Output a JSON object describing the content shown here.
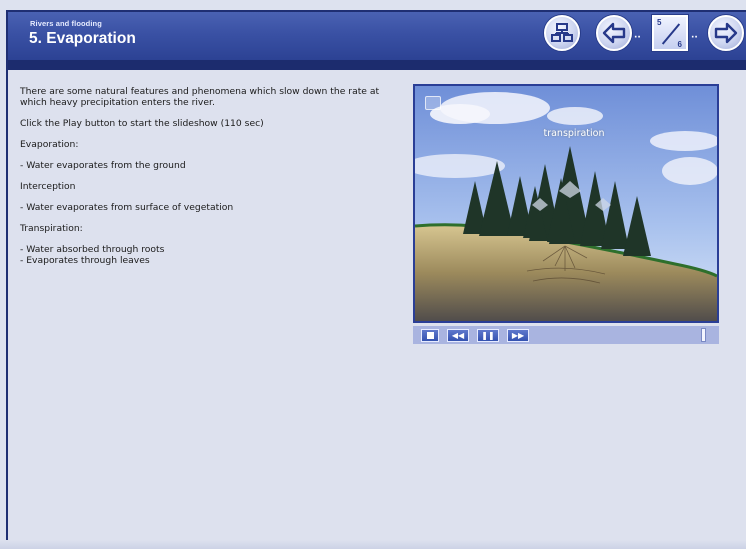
{
  "header": {
    "subtitle": "Rivers and flooding",
    "title": "5. Evaporation"
  },
  "nav": {
    "page_current": "5",
    "page_total": "6",
    "dots": "··"
  },
  "content": {
    "intro": "There are some natural features and phenomena which slow down the rate at which heavy precipitation enters the river.",
    "instruction": "Click the Play button to start the slideshow (110 sec)",
    "sections": [
      {
        "heading": "Evaporation:",
        "body": [
          "- Water evaporates from the ground"
        ]
      },
      {
        "heading": "Interception",
        "body": [
          "- Water evaporates from surface of vegetation"
        ]
      },
      {
        "heading": "Transpiration:",
        "body": [
          "- Water absorbed through roots",
          "- Evaporates through leaves"
        ]
      }
    ]
  },
  "player": {
    "scene_label": "transpiration",
    "progress": 0.97,
    "buttons": [
      "stop",
      "rewind",
      "pause",
      "fast-forward"
    ]
  },
  "colors": {
    "header": "#3a51a4",
    "header_strip": "#1c2c6e",
    "background": "#dde1ee",
    "player_border": "#2a3e96",
    "control_bar": "#a9b4e0",
    "control_button": "#3452b0"
  }
}
